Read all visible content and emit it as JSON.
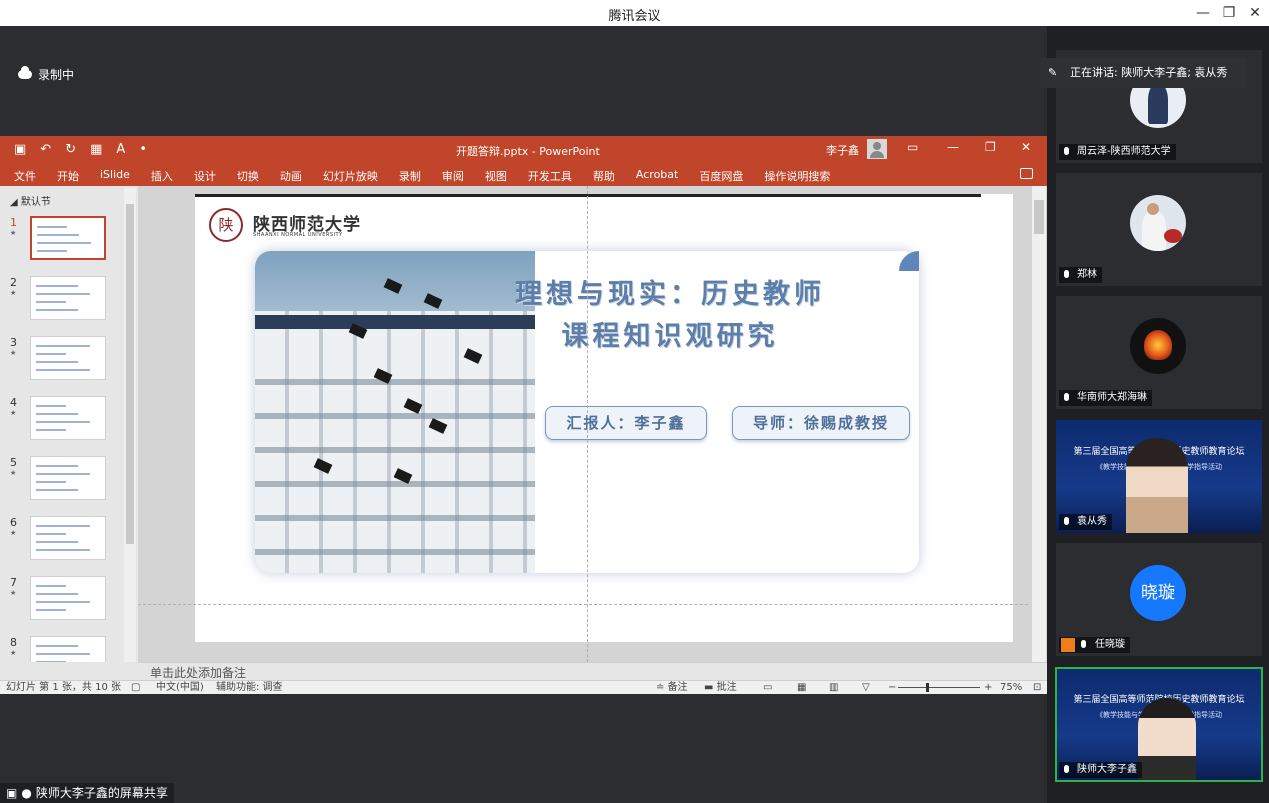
{
  "window": {
    "title": "腾讯会议",
    "minimize": "—",
    "restore": "❐",
    "close": "✕"
  },
  "meeting": {
    "recording_label": "录制中",
    "speaking_label": "正在讲话: 陕师大李子鑫; 袁从秀",
    "screen_share_label": "陕师大李子鑫的屏幕共享"
  },
  "powerpoint": {
    "doc_title": "开题答辩.pptx  -  PowerPoint",
    "user_name": "李子鑫",
    "ribbon_tabs": [
      "文件",
      "开始",
      "iSlide",
      "插入",
      "设计",
      "切换",
      "动画",
      "幻灯片放映",
      "录制",
      "审阅",
      "视图",
      "开发工具",
      "帮助",
      "Acrobat",
      "百度网盘",
      "操作说明搜索"
    ],
    "section_label": "默认节",
    "thumbnails": [
      "1",
      "2",
      "3",
      "4",
      "5",
      "6",
      "7",
      "8"
    ],
    "notes_placeholder": "单击此处添加备注",
    "status": {
      "slide_info": "幻灯片 第 1 张，共 10 张",
      "language": "中文(中国)",
      "accessibility": "辅助功能: 调查",
      "notes": "备注",
      "comments": "批注",
      "zoom": "75%"
    }
  },
  "slide": {
    "logo_seal": "陕",
    "logo_name": "陕西师范大学",
    "logo_sub": "SHAANXI NORMAL UNIVERSITY",
    "title_line1": "理想与现实：历史教师",
    "title_line2": "课程知识观研究",
    "presenter": "汇报人：李子鑫",
    "advisor": "导师：徐赐成教授"
  },
  "participants": [
    {
      "name": "周云泽-陕西师范大学",
      "type": "photo"
    },
    {
      "name": "郑林",
      "type": "photo"
    },
    {
      "name": "华南师大郑海琳",
      "type": "photo"
    },
    {
      "name": "袁从秀",
      "type": "video",
      "banner_title": "第三届全国高等师范院校历史教师教育论坛",
      "banner_sub": "《教学技能与学科育人》暨教学指导活动"
    },
    {
      "name": "任晓璇",
      "type": "avatar",
      "avatar_text": "晓璇",
      "avatar_color": "#1677ff"
    },
    {
      "name": "陕师大李子鑫",
      "type": "video",
      "banner_title": "第三届全国高等师范院校历史教师教育论坛",
      "banner_sub": "《教学技能与学科育人》暨教学指导活动"
    }
  ],
  "colors": {
    "ppt_accent": "#c0452a",
    "slide_title": "#5d7ea8",
    "active_speaker_border": "#2fb24a"
  }
}
